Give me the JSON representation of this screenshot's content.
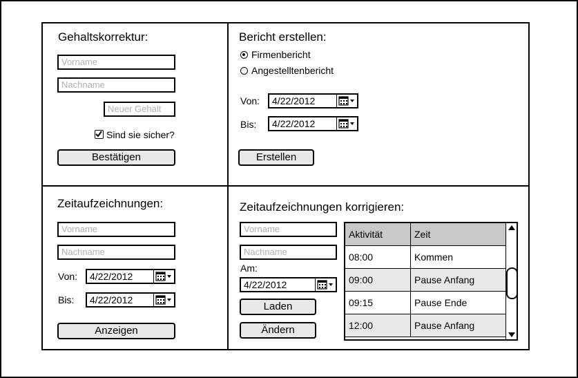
{
  "salary": {
    "title": "Gehaltskorrektur:",
    "first_name_placeholder": "Vorname",
    "last_name_placeholder": "Nachname",
    "new_salary_placeholder": "Neuer Gehalt",
    "confirm_check_label": "Sind sie sicher?",
    "confirm_checked": true,
    "submit_label": "Bestätigen"
  },
  "report": {
    "title": "Bericht erstellen:",
    "options": [
      "Firmenbericht",
      "Angestelltenbericht"
    ],
    "selected_option": "Firmenbericht",
    "from_label": "Von:",
    "from_value": "4/22/2012",
    "to_label": "Bis:",
    "to_value": "4/22/2012",
    "create_label": "Erstellen"
  },
  "records": {
    "title": "Zeitaufzeichnungen:",
    "first_name_placeholder": "Vorname",
    "last_name_placeholder": "Nachname",
    "from_label": "Von:",
    "from_value": "4/22/2012",
    "to_label": "Bis:",
    "to_value": "4/22/2012",
    "show_label": "Anzeigen"
  },
  "correct": {
    "title": "Zeitaufzeichnungen korrigieren:",
    "first_name_placeholder": "Vorname",
    "last_name_placeholder": "Nachname",
    "date_label": "Am:",
    "date_value": "4/22/2012",
    "load_label": "Laden",
    "change_label": "Ändern",
    "table": {
      "headers": [
        "Aktivität",
        "Zeit"
      ],
      "rows": [
        [
          "08:00",
          "Kommen"
        ],
        [
          "09:00",
          "Pause Anfang"
        ],
        [
          "09:15",
          "Pause Ende"
        ],
        [
          "12:00",
          "Pause Anfang"
        ]
      ]
    }
  }
}
